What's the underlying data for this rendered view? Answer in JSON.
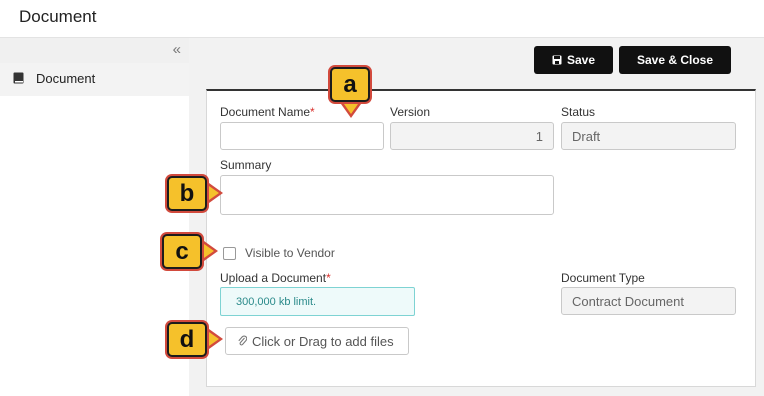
{
  "header": {
    "title": "Document"
  },
  "sidebar": {
    "collapse_glyph": "«",
    "items": [
      {
        "label": "Document",
        "icon": "book-icon"
      }
    ]
  },
  "toolbar": {
    "save_label": "Save",
    "save_close_label": "Save & Close"
  },
  "form": {
    "document_name": {
      "label": "Document Name",
      "required_mark": "*",
      "value": ""
    },
    "version": {
      "label": "Version",
      "value": "1"
    },
    "status": {
      "label": "Status",
      "value": "Draft"
    },
    "summary": {
      "label": "Summary",
      "value": ""
    },
    "visible_to_vendor": {
      "label": "Visible to Vendor",
      "checked": false
    },
    "upload": {
      "label": "Upload a Document",
      "required_mark": "*",
      "limit_text": "300,000 kb limit.",
      "dropzone_text": "Click or Drag to add files"
    },
    "document_type": {
      "label": "Document Type",
      "value": "Contract Document"
    }
  },
  "callouts": {
    "a": "a",
    "b": "b",
    "c": "c",
    "d": "d"
  },
  "colors": {
    "button_bg": "#111111",
    "required": "#d9302c",
    "callout_fill": "#f5c12b",
    "callout_outline": "#d24a3d",
    "limit_border": "#7ed3d3"
  }
}
